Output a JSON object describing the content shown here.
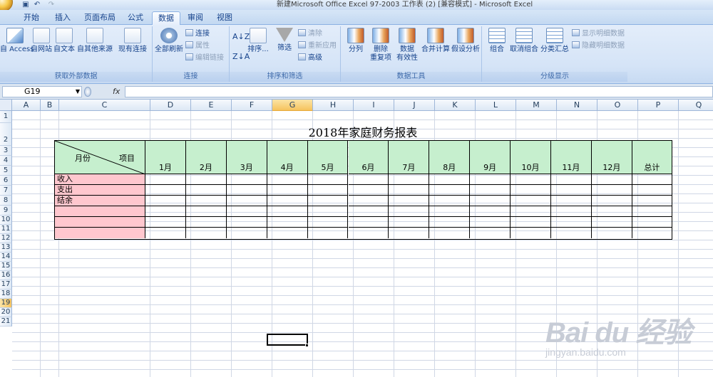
{
  "window": {
    "title": "新建Microsoft Office Excel 97-2003 工作表 (2)  [兼容模式] - Microsoft Excel"
  },
  "quick_access": {
    "icons": [
      "save-icon",
      "undo-icon",
      "redo-icon"
    ]
  },
  "ribbon": {
    "tabs": [
      {
        "label": "开始",
        "active": false
      },
      {
        "label": "插入",
        "active": false
      },
      {
        "label": "页面布局",
        "active": false
      },
      {
        "label": "公式",
        "active": false
      },
      {
        "label": "数据",
        "active": true
      },
      {
        "label": "审阅",
        "active": false
      },
      {
        "label": "视图",
        "active": false
      }
    ],
    "groups": {
      "external": {
        "label": "获取外部数据",
        "buttons": {
          "access": "自 Access",
          "web": "自网站",
          "text": "自文本",
          "other": "自其他来源",
          "existing": "现有连接"
        }
      },
      "connections": {
        "label": "连接",
        "refresh": "全部刷新",
        "connect": "连接",
        "props": "属性",
        "edit_links": "编辑链接"
      },
      "sort_filter": {
        "label": "排序和筛选",
        "sort": "排序...",
        "filter": "筛选",
        "clear": "清除",
        "reapply": "重新应用",
        "advanced": "高级"
      },
      "data_tools": {
        "label": "数据工具",
        "split": "分列",
        "remove_dup_1": "删除",
        "remove_dup_2": "重复项",
        "validation_1": "数据",
        "validation_2": "有效性",
        "consolidate": "合并计算",
        "what_if": "假设分析"
      },
      "outline": {
        "label": "分级显示",
        "group": "组合",
        "ungroup": "取消组合",
        "subtotal": "分类汇总",
        "show_detail": "显示明细数据",
        "hide_detail": "隐藏明细数据"
      }
    }
  },
  "formula_bar": {
    "name_box": "G19",
    "fx": "fx",
    "value": ""
  },
  "sheet": {
    "columns": [
      "A",
      "B",
      "C",
      "D",
      "E",
      "F",
      "G",
      "H",
      "I",
      "J",
      "K",
      "L",
      "M",
      "N",
      "O",
      "P",
      "Q"
    ],
    "selected_column": "G",
    "rows": [
      "1",
      "2",
      "3",
      "4",
      "5",
      "6",
      "7",
      "8",
      "9",
      "10",
      "11",
      "12",
      "13",
      "14",
      "15",
      "16",
      "17",
      "18",
      "19",
      "20",
      "21"
    ],
    "selected_row": "19"
  },
  "table": {
    "title": "2018年家庭财务报表",
    "corner_top": "项目",
    "corner_bottom": "月份",
    "headers": [
      "1月",
      "2月",
      "3月",
      "4月",
      "5月",
      "6月",
      "7月",
      "8月",
      "9月",
      "10月",
      "11月",
      "12月",
      "总计"
    ],
    "row_labels": [
      "收入",
      "支出",
      "结余",
      "",
      "",
      ""
    ]
  },
  "watermark": {
    "logo": "Bai du 经验",
    "url": "jingyan.baidu.com"
  }
}
